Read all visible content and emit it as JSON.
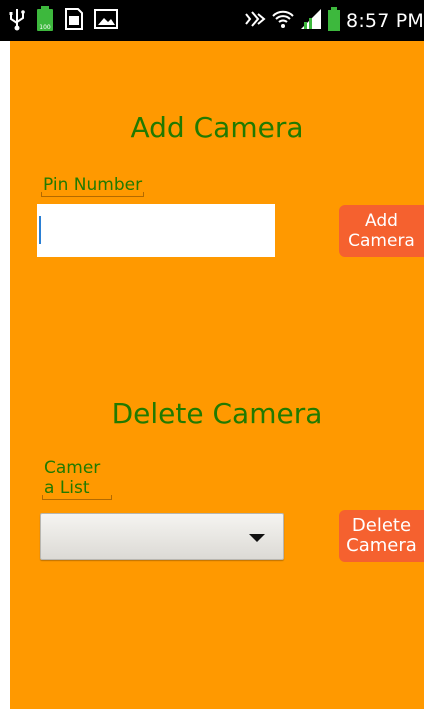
{
  "status_bar": {
    "time": "8:57 PM",
    "left_icons": [
      "usb-icon",
      "battery-full-icon",
      "sim-card-icon",
      "image-icon"
    ],
    "right_icons": [
      "nfc-icon",
      "wifi-icon",
      "signal-icon",
      "battery-icon"
    ]
  },
  "add_section": {
    "title": "Add Camera",
    "pin_label": "Pin Number",
    "pin_value": "",
    "button_line1": "Add",
    "button_line2": "Camera"
  },
  "delete_section": {
    "title": "Delete Camera",
    "list_label_line1": "Camer",
    "list_label_line2": "a List",
    "dropdown_selected": "",
    "button_line1": "Delete",
    "button_line2": "Camera"
  },
  "colors": {
    "background": "#ff9900",
    "title_text": "#217a00",
    "button": "#f5612f",
    "status_bar": "#000000"
  }
}
